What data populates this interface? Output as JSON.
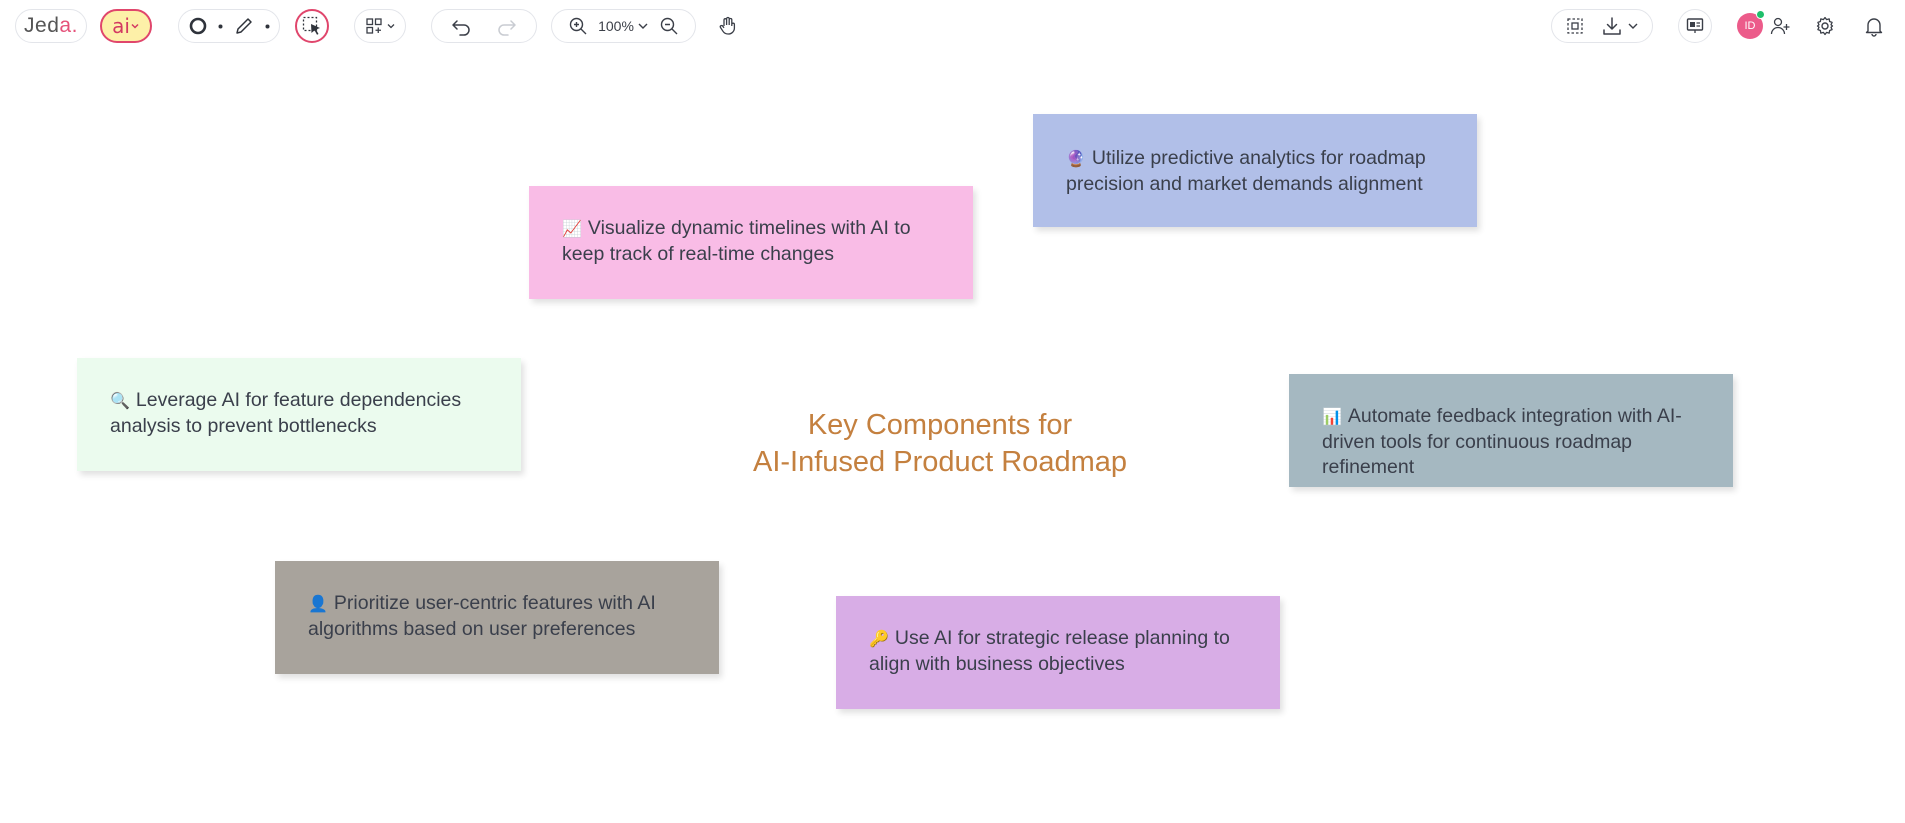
{
  "toolbar": {
    "logo_text": "Jed",
    "logo_accent": "a",
    "logo_suffix": ".",
    "ai_label": "ai",
    "zoom_level": "100%"
  },
  "user": {
    "initials": "ID"
  },
  "canvas": {
    "title_line1": "Key Components for",
    "title_line2": "AI-Infused Product Roadmap",
    "notes": [
      {
        "emoji": "📈",
        "text": "Visualize dynamic timelines with AI to keep track of real-time changes",
        "color": "#f9bce6"
      },
      {
        "emoji": "🔮",
        "text": "Utilize predictive analytics for roadmap precision and market demands alignment",
        "color": "#b1bfe8"
      },
      {
        "emoji": "🔍",
        "text": "Leverage AI for feature dependencies analysis to prevent bottlenecks",
        "color": "#ebfbee"
      },
      {
        "emoji": "📊",
        "text": "Automate feedback integration with AI-driven tools for continuous roadmap refinement",
        "color": "#a5b8c1"
      },
      {
        "emoji": "👤",
        "text": "Prioritize user-centric features with AI algorithms based on user preferences",
        "color": "#a8a39c"
      },
      {
        "emoji": "🔑",
        "text": "Use AI for strategic release planning to align with business objectives",
        "color": "#d8ade6"
      }
    ]
  },
  "colors": {
    "accent": "#e0466c",
    "title": "#c4803f",
    "ai_bg": "#fdf0a8"
  }
}
